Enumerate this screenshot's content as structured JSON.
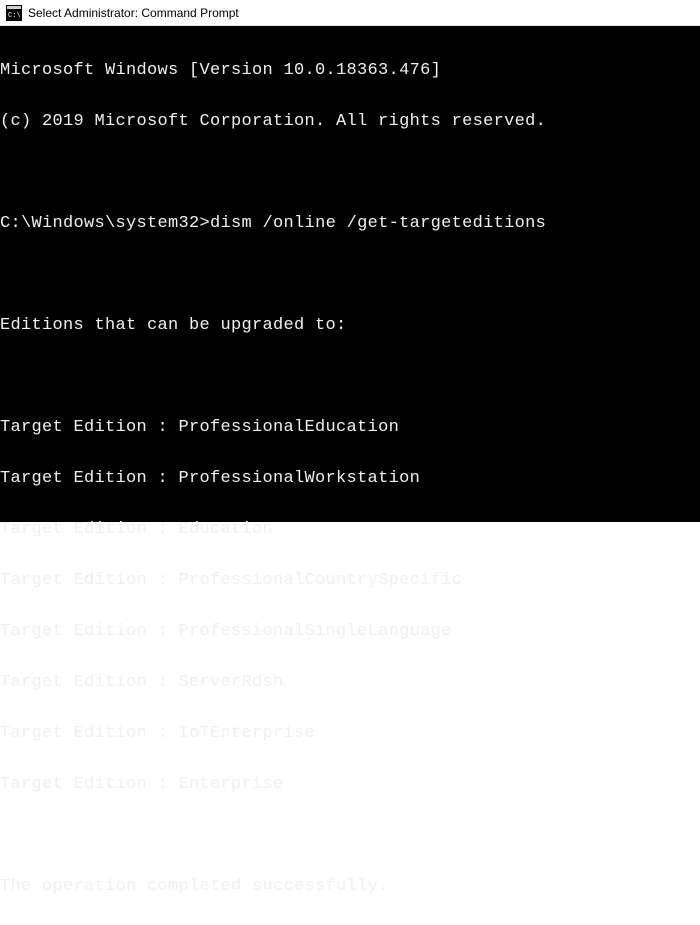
{
  "window": {
    "title": "Select Administrator: Command Prompt"
  },
  "terminal": {
    "banner_line1": "Microsoft Windows [Version 10.0.18363.476]",
    "banner_line2": "(c) 2019 Microsoft Corporation. All rights reserved.",
    "prompt": "C:\\Windows\\system32>",
    "command": "dism /online /get-targeteditions",
    "heading": "Editions that can be upgraded to:",
    "edition_label": "Target Edition : ",
    "editions": [
      "ProfessionalEducation",
      "ProfessionalWorkstation",
      "Education",
      "ProfessionalCountrySpecific",
      "ProfessionalSingleLanguage",
      "ServerRdsh",
      "IoTEnterprise",
      "Enterprise"
    ],
    "result": "The operation completed successfully."
  }
}
